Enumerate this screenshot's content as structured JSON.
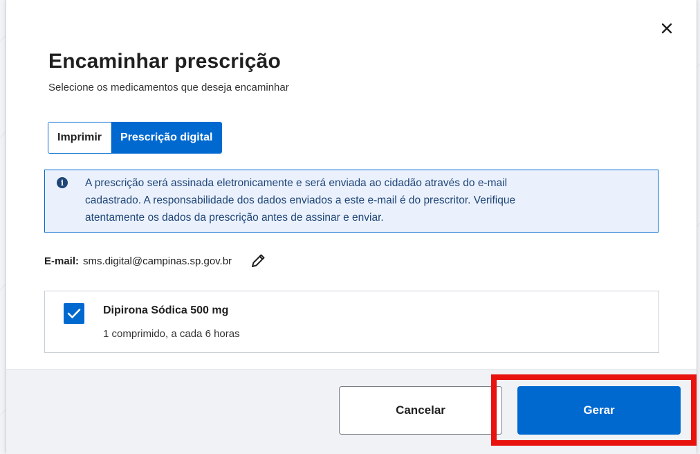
{
  "dialog": {
    "title": "Encaminhar prescrição",
    "subtitle": "Selecione os medicamentos que deseja encaminhar",
    "close_icon": "close-icon"
  },
  "toggle": {
    "options": [
      "Imprimir",
      "Prescrição digital"
    ],
    "selected": "Prescrição digital"
  },
  "info": {
    "icon": "info-icon",
    "lines": [
      "A prescrição será assinada eletronicamente e será enviada ao cidadão através do e-mail",
      "cadastrado. A responsabilidade dos dados enviados a este e-mail é do prescritor. Verifique",
      "atentamente os dados da prescrição antes de assinar e enviar."
    ]
  },
  "email": {
    "label": "E-mail:",
    "value": "sms.digital@campinas.sp.gov.br",
    "edit_icon": "pencil-icon"
  },
  "medications": [
    {
      "checked": true,
      "name": "Dipirona Sódica 500 mg",
      "dosage": "1 comprimido, a cada 6 horas"
    }
  ],
  "footer": {
    "cancel_label": "Cancelar",
    "generate_label": "Gerar"
  },
  "colors": {
    "primary": "#0069d0",
    "info_bg": "#eaf1fd",
    "info_text": "#1f4577",
    "highlight": "#e8130f"
  }
}
